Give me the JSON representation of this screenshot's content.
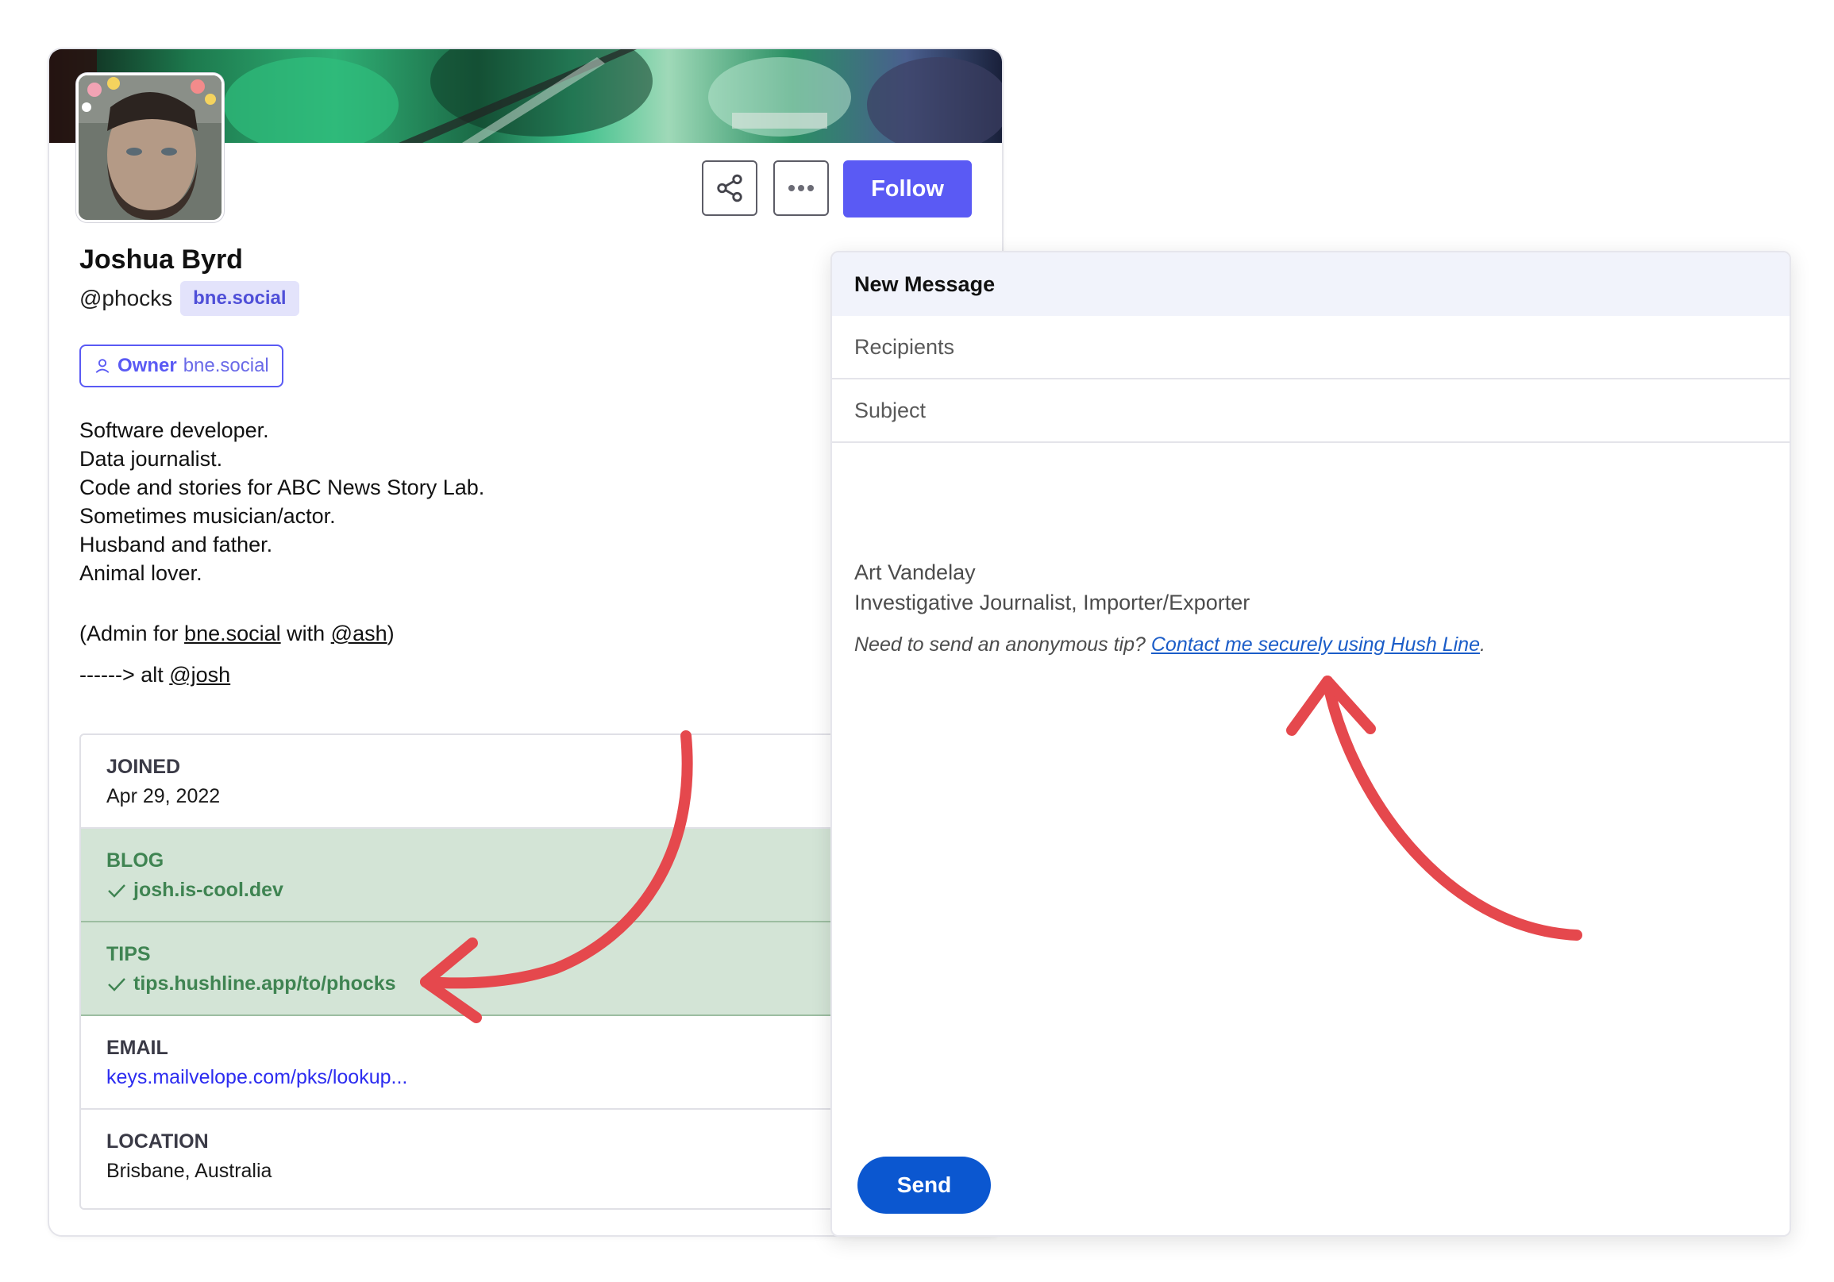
{
  "colors": {
    "accent": "#5a5af4",
    "verified_bg": "#d3e4d6",
    "verified_text": "#3f8452",
    "send_button": "#0b57d0",
    "annotation_arrow": "#e5484d"
  },
  "profile": {
    "display_name": "Joshua Byrd",
    "handle": "@phocks",
    "instance": "bne.social",
    "role_label": "Owner",
    "role_domain": "bne.social",
    "actions": {
      "share_icon": "share-icon",
      "more_icon": "more-horizontal-icon",
      "follow_label": "Follow"
    },
    "bio": {
      "lines": [
        "Software developer.",
        "Data journalist.",
        "Code and stories for ABC News Story Lab.",
        "Sometimes musician/actor.",
        "Husband and father.",
        "Animal lover."
      ],
      "admin_prefix": "(Admin for ",
      "admin_link": "bne.social",
      "admin_middle": " with ",
      "admin_mention": "@ash",
      "admin_suffix": ")",
      "alt_prefix": "------> alt ",
      "alt_mention": "@josh"
    },
    "fields": [
      {
        "label": "JOINED",
        "value": "Apr 29, 2022",
        "verified": false
      },
      {
        "label": "BLOG",
        "value": "josh.is-cool.dev",
        "verified": true
      },
      {
        "label": "TIPS",
        "value": "tips.hushline.app/to/phocks",
        "verified": true
      },
      {
        "label": "EMAIL",
        "value": "keys.mailvelope.com/pks/lookup...",
        "verified": false
      },
      {
        "label": "LOCATION",
        "value": "Brisbane, Australia",
        "verified": false
      }
    ]
  },
  "message": {
    "title": "New Message",
    "recipients_placeholder": "Recipients",
    "subject_placeholder": "Subject",
    "signature": {
      "name": "Art Vandelay",
      "title": "Investigative Journalist, Importer/Exporter",
      "tip_prefix": "Need to send an anonymous tip? ",
      "tip_link": "Contact me securely using Hush Line",
      "tip_suffix": "."
    },
    "send_label": "Send"
  }
}
